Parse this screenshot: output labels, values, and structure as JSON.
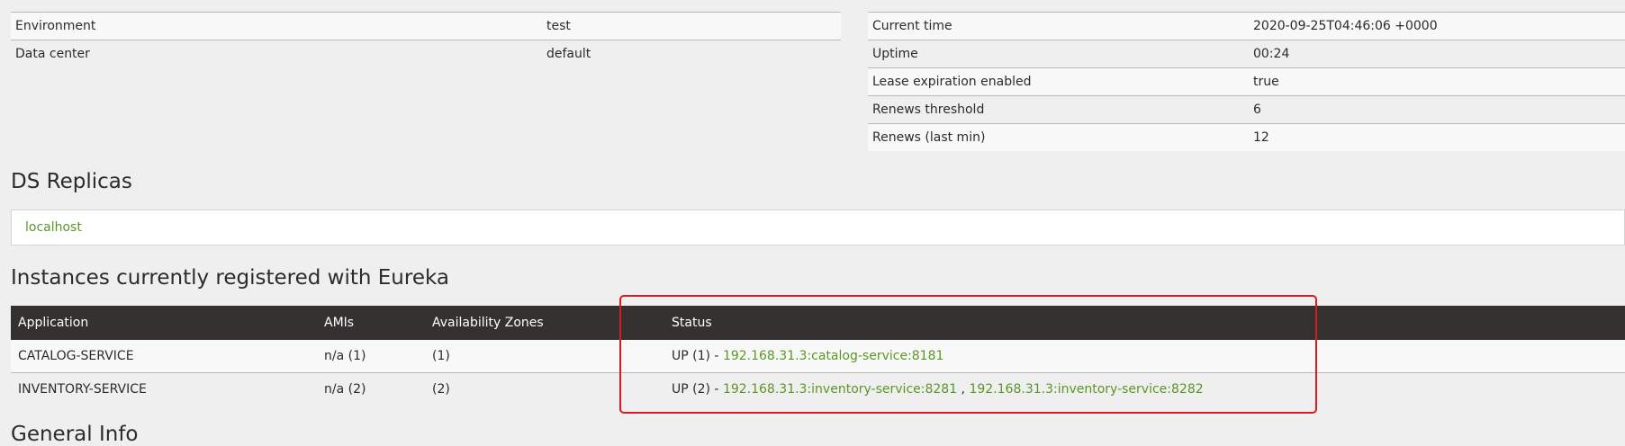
{
  "environment_info": {
    "rows": [
      {
        "key": "Environment",
        "value": "test"
      },
      {
        "key": "Data center",
        "value": "default"
      }
    ]
  },
  "status_info": {
    "rows": [
      {
        "key": "Current time",
        "value": "2020-09-25T04:46:06 +0000"
      },
      {
        "key": "Uptime",
        "value": "00:24"
      },
      {
        "key": "Lease expiration enabled",
        "value": "true"
      },
      {
        "key": "Renews threshold",
        "value": "6"
      },
      {
        "key": "Renews (last min)",
        "value": "12"
      }
    ]
  },
  "ds_replicas": {
    "title": "DS Replicas",
    "replica": "localhost"
  },
  "instances": {
    "title": "Instances currently registered with Eureka",
    "headers": [
      "Application",
      "AMIs",
      "Availability Zones",
      "Status"
    ],
    "rows": [
      {
        "application": "CATALOG-SERVICE",
        "amis": "n/a (1)",
        "zones": "(1)",
        "status_prefix": "UP (1) - ",
        "links": [
          "192.168.31.3:catalog-service:8181"
        ]
      },
      {
        "application": "INVENTORY-SERVICE",
        "amis": "n/a (2)",
        "zones": "(2)",
        "status_prefix": "UP (2) - ",
        "links": [
          "192.168.31.3:inventory-service:8281",
          "192.168.31.3:inventory-service:8282"
        ],
        "separator": " , "
      }
    ]
  },
  "general_info": {
    "title": "General Info"
  },
  "colors": {
    "link": "#5b9625",
    "header_bg": "#353130",
    "highlight": "#d51b24"
  }
}
